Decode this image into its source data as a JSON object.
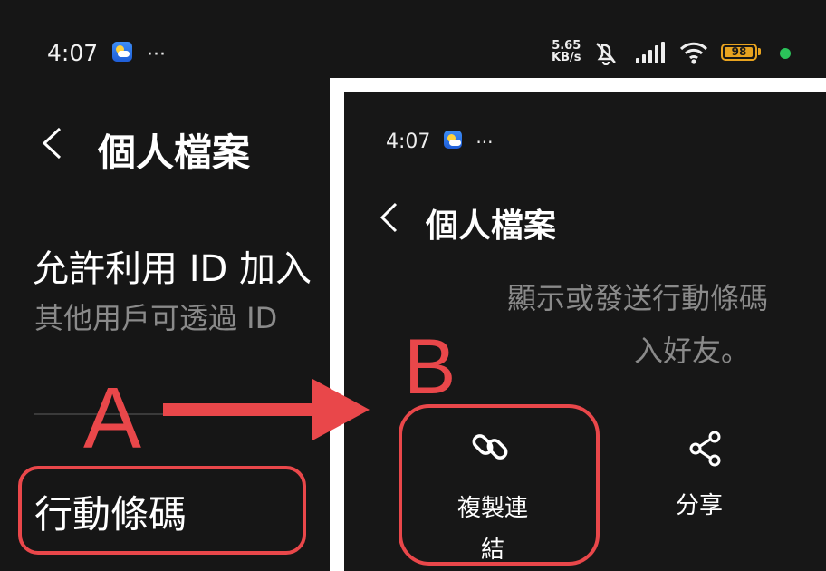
{
  "status_bar": {
    "time": "4:07",
    "more_glyph": "···",
    "net_speed_value": "5.65",
    "net_speed_unit": "KB/s",
    "battery_level": "98",
    "battery_fraction": 0.98,
    "icons": [
      "weather-icon",
      "mute-icon",
      "signal-icon",
      "wifi-icon",
      "battery-icon",
      "green-dot"
    ]
  },
  "header": {
    "back_glyph": "<",
    "title": "個人檔案"
  },
  "setting": {
    "title": "允許利用 ID 加入",
    "description": "其他用戶可透過 ID"
  },
  "action_item": "行動條碼",
  "annotations": {
    "label_a": "A",
    "label_b": "B",
    "color": "#e9474a"
  },
  "overlay": {
    "time": "4:07",
    "more_glyph": "···",
    "title": "個人檔案",
    "description_line1": "顯示或發送行動條碼",
    "description_line2": "入好友。",
    "copy_link_label": "複製連結",
    "share_label": "分享"
  }
}
